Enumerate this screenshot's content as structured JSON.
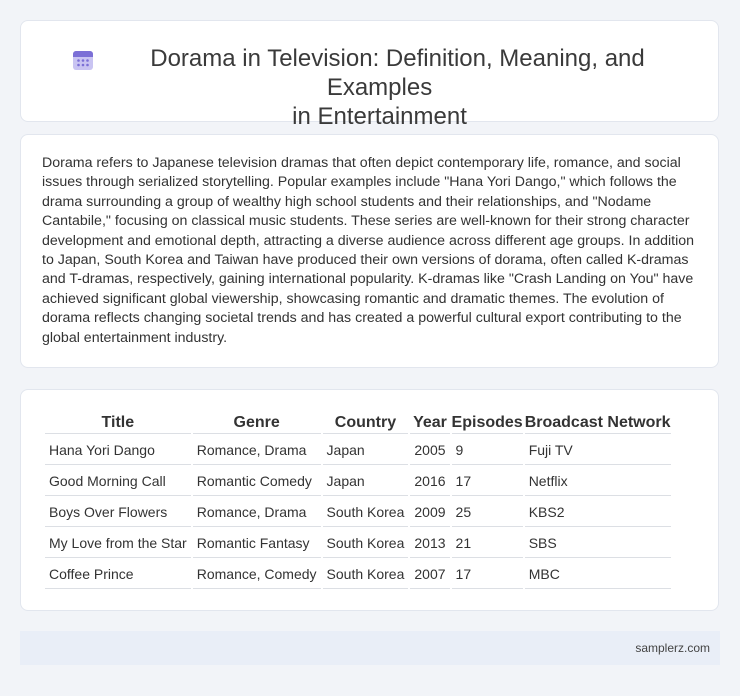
{
  "header": {
    "icon": "calendar-icon",
    "title_line1": "Dorama in Television: Definition, Meaning, and Examples",
    "title_line2": "in Entertainment"
  },
  "description": "Dorama refers to Japanese television dramas that often depict contemporary life, romance, and social issues through serialized storytelling. Popular examples include \"Hana Yori Dango,\" which follows the drama surrounding a group of wealthy high school students and their relationships, and \"Nodame Cantabile,\" focusing on classical music students. These series are well-known for their strong character development and emotional depth, attracting a diverse audience across different age groups. In addition to Japan, South Korea and Taiwan have produced their own versions of dorama, often called K-dramas and T-dramas, respectively, gaining international popularity. K-dramas like \"Crash Landing on You\" have achieved significant global viewership, showcasing romantic and dramatic themes. The evolution of dorama reflects changing societal trends and has created a powerful cultural export contributing to the global entertainment industry.",
  "table": {
    "headers": [
      "Title",
      "Genre",
      "Country",
      "Year",
      "Episodes",
      "Broadcast Network"
    ],
    "rows": [
      [
        "Hana Yori Dango",
        "Romance, Drama",
        "Japan",
        "2005",
        "9",
        "Fuji TV"
      ],
      [
        "Good Morning Call",
        "Romantic Comedy",
        "Japan",
        "2016",
        "17",
        "Netflix"
      ],
      [
        "Boys Over Flowers",
        "Romance, Drama",
        "South Korea",
        "2009",
        "25",
        "KBS2"
      ],
      [
        "My Love from the Star",
        "Romantic Fantasy",
        "South Korea",
        "2013",
        "21",
        "SBS"
      ],
      [
        "Coffee Prince",
        "Romance, Comedy",
        "South Korea",
        "2007",
        "17",
        "MBC"
      ]
    ]
  },
  "footer": {
    "site": "samplerz.com"
  },
  "colors": {
    "background": "#f2f4f8",
    "card": "#ffffff",
    "footer": "#e9eef7",
    "icon_accent": "#7b6fd6"
  }
}
